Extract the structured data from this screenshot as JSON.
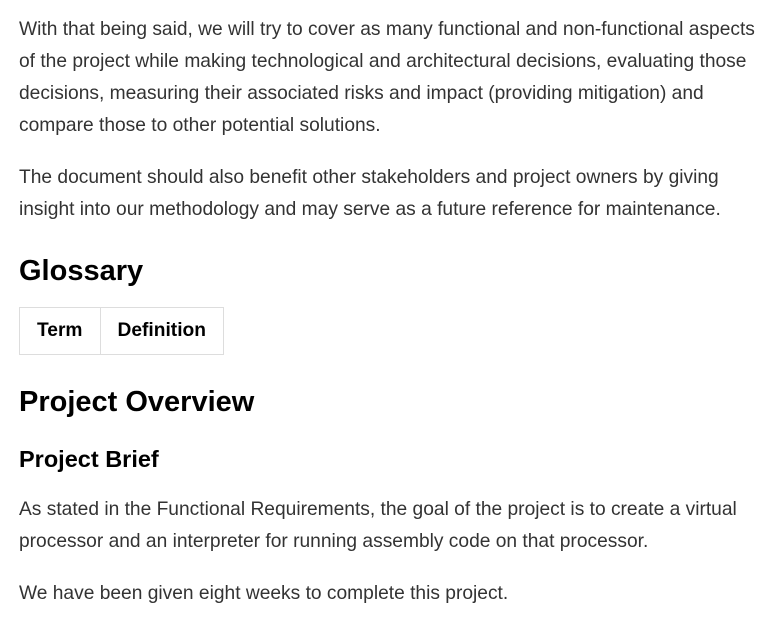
{
  "intro": {
    "paragraph1": "With that being said, we will try to cover as many functional and non-functional aspects of the project while making technological and architectural decisions, evaluating those decisions, measuring their associated risks and impact (providing mitigation) and compare those to other potential solutions.",
    "paragraph2": "The document should also benefit other stakeholders and project owners by giving insight into our methodology and may serve as a future reference for maintenance."
  },
  "glossary": {
    "heading": "Glossary",
    "table": {
      "headers": [
        "Term",
        "Definition"
      ]
    }
  },
  "overview": {
    "heading": "Project Overview",
    "brief": {
      "heading": "Project Brief",
      "paragraph1": "As stated in the Functional Requirements, the goal of the project is to create a virtual processor and an interpreter for running assembly code on that processor.",
      "paragraph2": "We have been given eight weeks to complete this project."
    }
  }
}
